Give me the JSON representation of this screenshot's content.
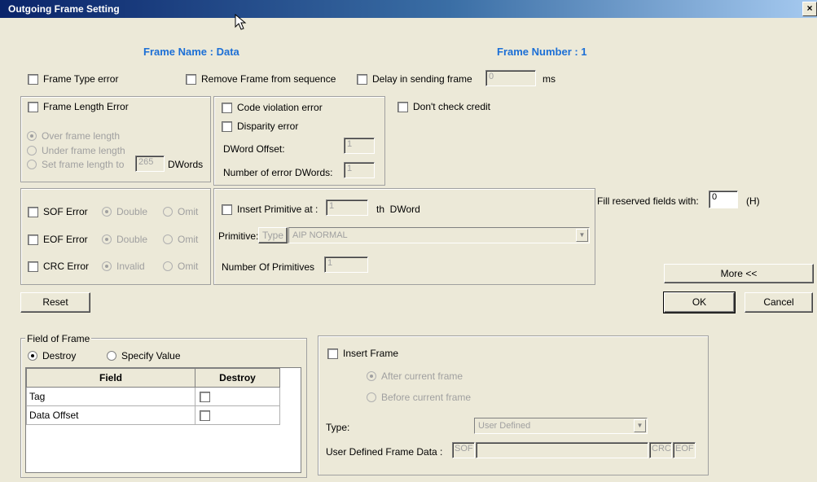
{
  "window": {
    "title": "Outgoing Frame Setting",
    "close": "×"
  },
  "header": {
    "frame_name": "Frame Name : Data",
    "frame_number": "Frame Number : 1"
  },
  "top_options": {
    "frame_type_error": "Frame Type error",
    "remove_frame": "Remove Frame from sequence",
    "delay_sending": "Delay in sending frame",
    "delay_value": "0",
    "delay_unit": "ms"
  },
  "frame_length": {
    "label": "Frame Length Error",
    "over": "Over frame length",
    "under": "Under frame length",
    "set_to": "Set frame length to",
    "set_value": "265",
    "unit": "DWords"
  },
  "code_group": {
    "code_violation": "Code violation error",
    "disparity": "Disparity error",
    "dword_offset_label": "DWord Offset:",
    "dword_offset_value": "1",
    "num_error_label": "Number of error DWords:",
    "num_error_value": "1"
  },
  "dont_check_credit": "Don't check credit",
  "sof_group": {
    "sof": "SOF Error",
    "eof": "EOF Error",
    "crc": "CRC Error",
    "double": "Double",
    "omit": "Omit",
    "invalid": "Invalid"
  },
  "primitive_group": {
    "insert_label": "Insert Primitive at :",
    "insert_value": "1",
    "th_dword": "th  DWord",
    "primitive_label": "Primitive:",
    "type_button": "Type",
    "primitive_value": "AIP NORMAL",
    "num_label": "Number Of Primitives",
    "num_value": "1"
  },
  "fill_reserved": {
    "label": "Fill reserved fields with:",
    "value": "0",
    "unit": "(H)"
  },
  "buttons": {
    "more": "More <<",
    "ok": "OK",
    "cancel": "Cancel",
    "reset": "Reset"
  },
  "field_of_frame": {
    "legend": "Field of Frame",
    "destroy": "Destroy",
    "specify": "Specify Value",
    "columns": [
      "Field",
      "Destroy"
    ],
    "rows": [
      {
        "field": "Tag"
      },
      {
        "field": "Data Offset"
      }
    ]
  },
  "insert_frame": {
    "label": "Insert Frame",
    "after": "After current frame",
    "before": "Before current frame",
    "type_label": "Type:",
    "type_value": "User Defined",
    "user_data_label": "User Defined Frame Data :",
    "sof": "SOF",
    "crc": "CRC",
    "eof": "EOF"
  }
}
